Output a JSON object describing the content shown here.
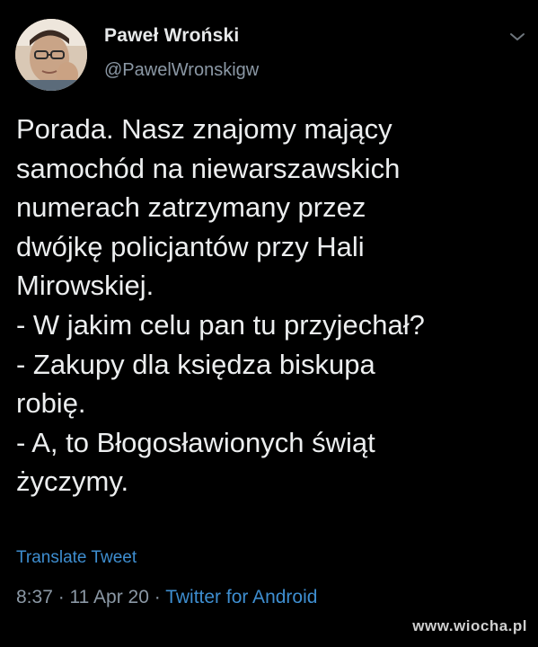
{
  "tweet": {
    "author": {
      "display_name": "Paweł Wroński",
      "handle": "@PawelWronskigw"
    },
    "text": "Porada. Nasz znajomy mający\nsamochód na niewarszawskich\nnumerach zatrzymany przez\ndwójkę policjantów przy Hali\nMirowskiej.\n- W jakim celu pan tu przyjechał?\n- Zakupy dla księdza biskupa\nrobię.\n- A, to Błogosławionych świąt\nżyczymy.",
    "translate_label": "Translate Tweet",
    "time": "8:37",
    "separator": " · ",
    "date": "11 Apr 20",
    "source": "Twitter for Android"
  },
  "watermark": "www.wiocha.pl",
  "icons": {
    "menu": "chevron-down-icon",
    "avatar": "avatar-photo"
  },
  "colors": {
    "background": "#000000",
    "text": "#e7e9ea",
    "secondary": "#8b98a5",
    "link": "#3e8ed0"
  }
}
